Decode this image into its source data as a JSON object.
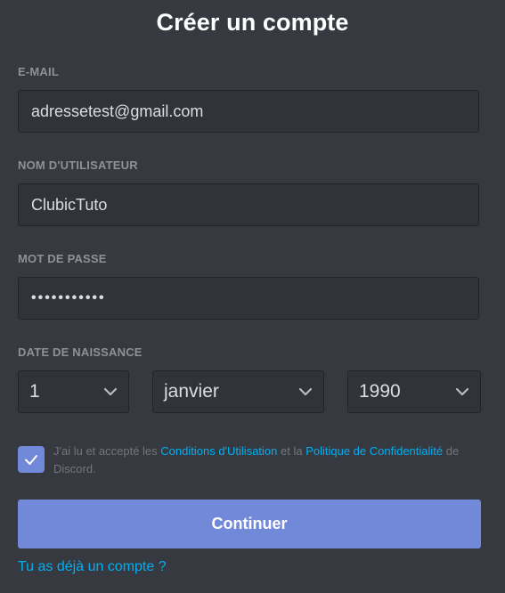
{
  "form": {
    "title": "Créer un compte",
    "email": {
      "label": "E-MAIL",
      "value": "adressetest@gmail.com"
    },
    "username": {
      "label": "NOM D'UTILISATEUR",
      "value": "ClubicTuto"
    },
    "password": {
      "label": "MOT DE PASSE",
      "masked_value": "•••••••••••"
    },
    "birthdate": {
      "label": "DATE DE NAISSANCE",
      "day": "1",
      "month": "janvier",
      "year": "1990"
    },
    "terms": {
      "checked": true,
      "text_before": "J'ai lu et accepté les ",
      "tos_link": "Conditions d'Utilisation",
      "text_middle": " et la ",
      "privacy_link": "Politique de Confidentialité",
      "text_after": " de Discord."
    },
    "submit_label": "Continuer",
    "login_link": "Tu as déjà un compte ?"
  },
  "colors": {
    "background": "#36393f",
    "input_background": "#303339",
    "accent": "#7289da",
    "link": "#00b0f4",
    "label": "#8e9297"
  },
  "icons": {
    "dropdown": "chevron-down-icon",
    "checkbox": "checkmark-icon"
  }
}
